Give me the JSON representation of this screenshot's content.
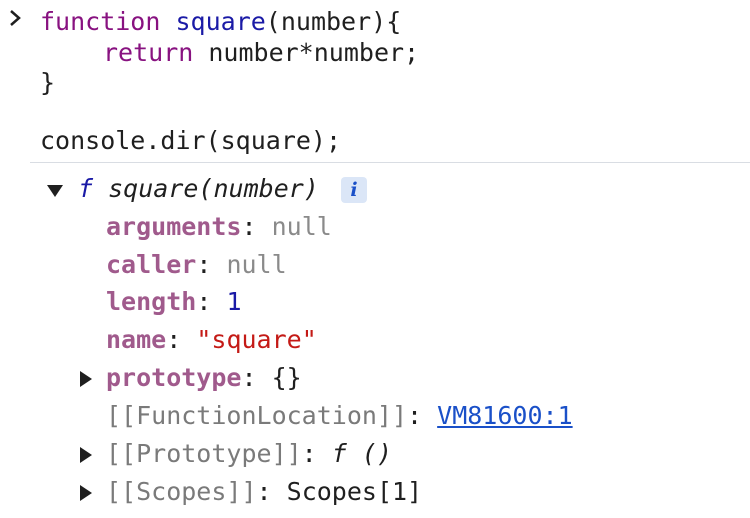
{
  "input": {
    "prompt_icon": "chevron-right-icon",
    "line1": {
      "keyword": "function",
      "name": "square",
      "args": "(number){"
    },
    "line2": {
      "keyword": "return",
      "expr": "number*number;"
    },
    "line3": "}",
    "line5": "console.dir(square);"
  },
  "output": {
    "header": {
      "f_symbol": "f",
      "signature": "square(number)",
      "info_label": "i"
    },
    "properties": [
      {
        "key": "arguments",
        "sep": ":",
        "value": "null"
      },
      {
        "key": "caller",
        "sep": ":",
        "value": "null"
      },
      {
        "key": "length",
        "sep": ":",
        "value": "1"
      },
      {
        "key": "name",
        "sep": ":",
        "value": "\"square\""
      },
      {
        "key": "prototype",
        "sep": ":",
        "value": "{}"
      }
    ],
    "internals": [
      {
        "key": "[[FunctionLocation]]",
        "sep": ":",
        "value": "VM81600:1"
      },
      {
        "key": "[[Prototype]]",
        "sep": ":",
        "value": "f ()"
      },
      {
        "key": "[[Scopes]]",
        "sep": ":",
        "value": "Scopes[1]"
      }
    ]
  },
  "colors": {
    "keyword": "#881280",
    "function_name": "#1a1aa6",
    "property_key": "#a05a8c",
    "null": "#8a8a8a",
    "number": "#1a1aa6",
    "string": "#c41a16",
    "link": "#1a50c8"
  }
}
